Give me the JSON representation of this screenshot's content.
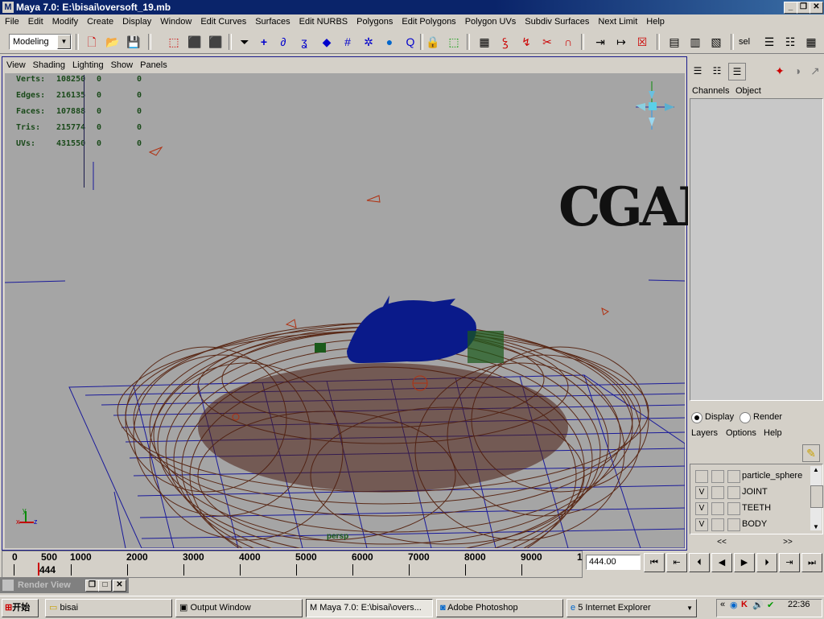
{
  "window": {
    "title": "Maya 7.0: E:\\bisai\\oversoft_19.mb",
    "controls": [
      "_",
      "❐",
      "✕"
    ]
  },
  "menu": [
    "File",
    "Edit",
    "Modify",
    "Create",
    "Display",
    "Window",
    "Edit Curves",
    "Surfaces",
    "Edit NURBS",
    "Polygons",
    "Edit Polygons",
    "Polygon UVs",
    "Subdiv Surfaces",
    "Next Limit",
    "Help"
  ],
  "shelf": {
    "mode": "Modeling",
    "sel_label": "sel"
  },
  "viewport": {
    "menu": [
      "View",
      "Shading",
      "Lighting",
      "Show",
      "Panels"
    ],
    "hud": [
      {
        "label": "Verts:",
        "value": "108250",
        "a": "0",
        "b": "0"
      },
      {
        "label": "Edges:",
        "value": "216135",
        "a": "0",
        "b": "0"
      },
      {
        "label": "Faces:",
        "value": "107888",
        "a": "0",
        "b": "0"
      },
      {
        "label": "Tris:",
        "value": "215774",
        "a": "0",
        "b": "0"
      },
      {
        "label": "UVs:",
        "value": "431550",
        "a": "0",
        "b": "0"
      }
    ],
    "watermark": "CGARFIST",
    "camera_label": "persp",
    "axis": {
      "y": "y",
      "x": "x",
      "z": "z"
    }
  },
  "channel_box": {
    "tabs": [
      "Channels",
      "Object"
    ]
  },
  "layer_editor": {
    "display_label": "Display",
    "render_label": "Render",
    "display_selected": true,
    "menu": [
      "Layers",
      "Options",
      "Help"
    ],
    "layers": [
      {
        "v": "",
        "name": "particle_sphere"
      },
      {
        "v": "V",
        "name": "JOINT"
      },
      {
        "v": "V",
        "name": "TEETH"
      },
      {
        "v": "V",
        "name": "BODY"
      }
    ],
    "nav_left": "<<",
    "nav_right": ">>"
  },
  "timeline": {
    "ticks": [
      "0",
      "500",
      "1000",
      "2000",
      "3000",
      "4000",
      "5000",
      "6000",
      "7000",
      "8000",
      "9000",
      "1"
    ],
    "current_frame_marker": "444",
    "current_frame": "444.00"
  },
  "render_view": {
    "label": "Render View"
  },
  "taskbar": {
    "start": "开始",
    "tasks": [
      "bisai",
      "Output Window",
      "Maya 7.0: E:\\bisai\\overs...",
      "Adobe Photoshop",
      "5 Internet Explorer"
    ],
    "clock": "22:36"
  },
  "colors": {
    "titlebar": "#0a246a",
    "viewport_bg": "#a5a5a5",
    "fur": "#5a2a18",
    "creature": "#0a1a8a",
    "grid": "#1a1a9a"
  }
}
